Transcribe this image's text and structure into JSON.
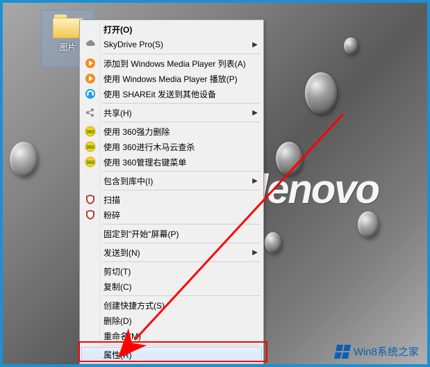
{
  "desktop": {
    "folder_label": "图片",
    "background_brand": "lenovo"
  },
  "menu": {
    "open": {
      "label": "打开(O)"
    },
    "skydrive": {
      "label": "SkyDrive Pro(S)"
    },
    "wmp_add": {
      "label": "添加到 Windows Media Player 列表(A)"
    },
    "wmp_play": {
      "label": "使用 Windows Media Player 播放(P)"
    },
    "shareit": {
      "label": "使用 SHAREit 发送到其他设备"
    },
    "share": {
      "label": "共享(H)"
    },
    "del360": {
      "label": "使用 360强力删除"
    },
    "scan360": {
      "label": "使用 360进行木马云查杀"
    },
    "mgr360": {
      "label": "使用 360管理右键菜单"
    },
    "include": {
      "label": "包含到库中(I)"
    },
    "scan": {
      "label": "扫描"
    },
    "shred": {
      "label": "粉碎"
    },
    "pin": {
      "label": "固定到\"开始\"屏幕(P)"
    },
    "sendto": {
      "label": "发送到(N)"
    },
    "cut": {
      "label": "剪切(T)"
    },
    "copy": {
      "label": "复制(C)"
    },
    "shortcut": {
      "label": "创建快捷方式(S)"
    },
    "delete": {
      "label": "删除(D)"
    },
    "rename": {
      "label": "重命名(M)"
    },
    "properties": {
      "label": "属性(R)"
    }
  },
  "watermark": {
    "text": "Win8系统之家"
  }
}
